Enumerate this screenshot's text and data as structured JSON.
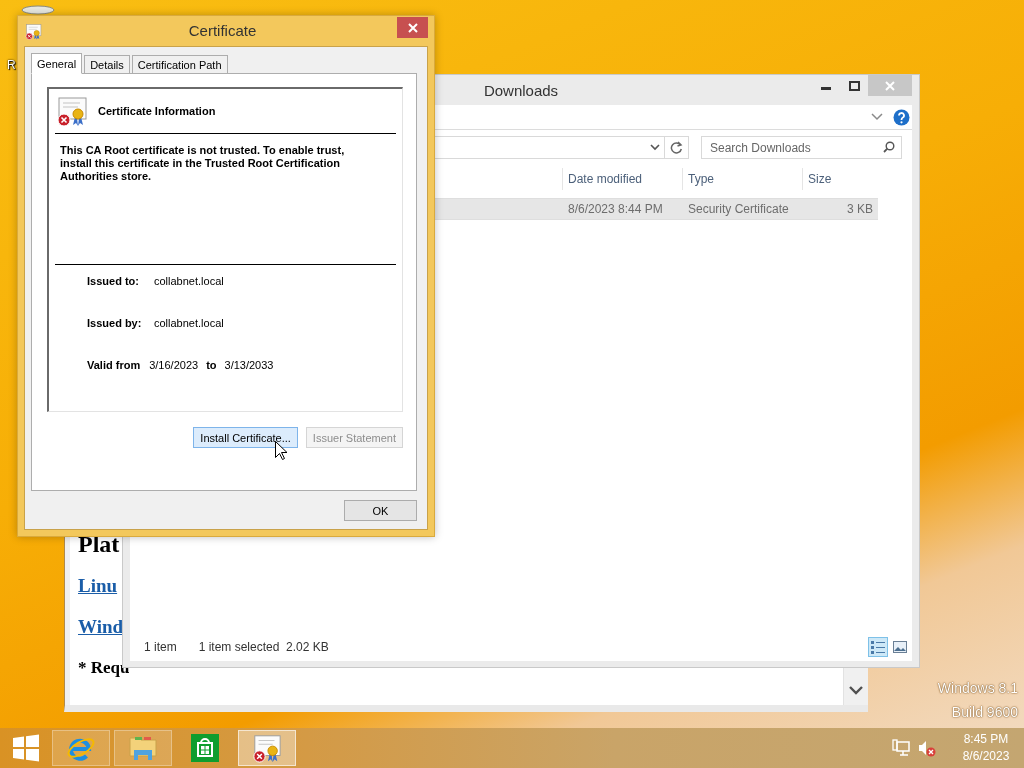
{
  "desktop": {
    "icon_label": "R",
    "watermark": [
      "Windows 8.1",
      "Build 9600"
    ]
  },
  "browser": {
    "lines": [
      {
        "kind": "heading",
        "text": "Plat"
      },
      {
        "kind": "link",
        "text": "Linu"
      },
      {
        "kind": "link",
        "text": "Wind"
      },
      {
        "kind": "note",
        "text": "* Requ"
      }
    ]
  },
  "explorer": {
    "title": "Downloads",
    "search": {
      "placeholder": "Search Downloads"
    },
    "columns": [
      "Date modified",
      "Type",
      "Size"
    ],
    "rows": [
      {
        "cells": [
          "8/6/2023 8:44 PM",
          "Security Certificate",
          "3 KB"
        ],
        "selected": true
      }
    ],
    "status": [
      "1 item",
      "1 item selected  2.02 KB"
    ],
    "views": [
      {
        "kind": "details",
        "selected": true
      },
      {
        "kind": "thumbnails",
        "selected": false
      }
    ]
  },
  "dialog": {
    "title": "Certificate",
    "tabs": [
      {
        "label": "General",
        "selected": true
      },
      {
        "label": "Details",
        "selected": false
      },
      {
        "label": "Certification Path",
        "selected": false
      }
    ],
    "heading": "Certificate Information",
    "message": "This CA Root certificate is not trusted. To enable trust, install this certificate in the Trusted Root Certification Authorities store.",
    "fields": [
      {
        "label": "Issued to:",
        "value": "collabnet.local"
      },
      {
        "label": "Issued by:",
        "value": "collabnet.local"
      }
    ],
    "validity": {
      "label": "Valid from",
      "from": "3/16/2023",
      "joiner": "to",
      "to": "3/13/2033"
    },
    "buttons": [
      {
        "label": "Install Certificate...",
        "hovered": true,
        "disabled": false
      },
      {
        "label": "Issuer Statement",
        "hovered": false,
        "disabled": true
      }
    ],
    "ok": "OK"
  },
  "taskbar": {
    "apps": [
      {
        "kind": "browser",
        "running": true,
        "selected": false
      },
      {
        "kind": "files",
        "running": true,
        "selected": false
      },
      {
        "kind": "store",
        "running": false,
        "selected": false
      },
      {
        "kind": "certificate",
        "running": true,
        "selected": true
      }
    ],
    "clock": {
      "time": "8:45 PM",
      "date": "8/6/2023"
    }
  }
}
